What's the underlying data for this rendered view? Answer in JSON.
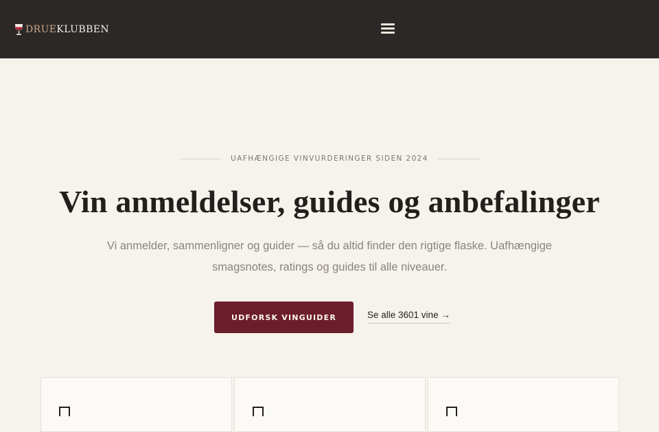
{
  "header": {
    "logo_part1": "DRUE",
    "logo_part2": "KLUBBEN",
    "logo_icon": "wine-glass-icon",
    "menu_icon": "hamburger-menu-icon",
    "background": "#2b2827"
  },
  "hero": {
    "eyebrow": "UAFHÆNGIGE VINVURDERINGER SIDEN 2024",
    "title": "Vin anmeldelser, guides og anbefalinger",
    "subtitle": "Vi anmelder, sammenligner og guider — så du altid finder den rigtige flaske. Uafhængige smagsnotes, ratings og guides til alle niveauer.",
    "primary_button": "UDFORSK VINGUIDER",
    "secondary_link": "Se alle 3601 vine →",
    "accent": "#6c1d2c"
  },
  "cards": [
    {
      "icon": "outline-square-icon"
    },
    {
      "icon": "outline-square-icon"
    },
    {
      "icon": "outline-square-icon"
    }
  ]
}
